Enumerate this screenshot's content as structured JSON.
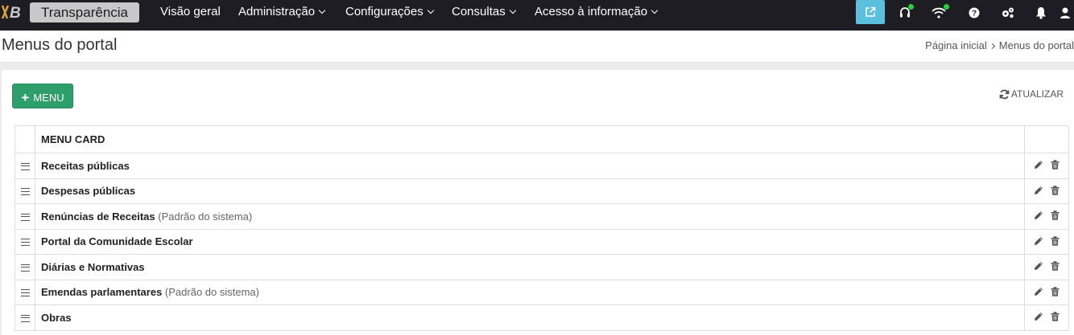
{
  "topbar": {
    "brand": "Transparência",
    "nav": [
      {
        "label": "Visão geral",
        "dropdown": false
      },
      {
        "label": "Administração",
        "dropdown": true
      },
      {
        "label": "Configurações",
        "dropdown": true
      },
      {
        "label": "Consultas",
        "dropdown": true
      },
      {
        "label": "Acesso à informação",
        "dropdown": true
      }
    ],
    "icons": [
      "external-link-icon",
      "headset-icon",
      "wifi-icon",
      "help-icon",
      "settings-icon",
      "bell-icon",
      "user-icon"
    ],
    "accent": "#5bc0de"
  },
  "header": {
    "title": "Menus do portal",
    "breadcrumb": [
      "Página inicial",
      "Menus do portal"
    ]
  },
  "toolbar": {
    "add_label": "MENU",
    "refresh_label": "ATUALIZAR",
    "add_color": "#2e9e6a"
  },
  "table": {
    "column_header": "MENU CARD",
    "rows": [
      {
        "name": "Receitas públicas",
        "note": ""
      },
      {
        "name": "Despesas públicas",
        "note": ""
      },
      {
        "name": "Renúncias de Receitas",
        "note": "(Padrão do sistema)"
      },
      {
        "name": "Portal da Comunidade Escolar",
        "note": ""
      },
      {
        "name": "Diárias e Normativas",
        "note": ""
      },
      {
        "name": "Emendas parlamentares",
        "note": "(Padrão do sistema)"
      },
      {
        "name": "Obras",
        "note": ""
      }
    ]
  }
}
